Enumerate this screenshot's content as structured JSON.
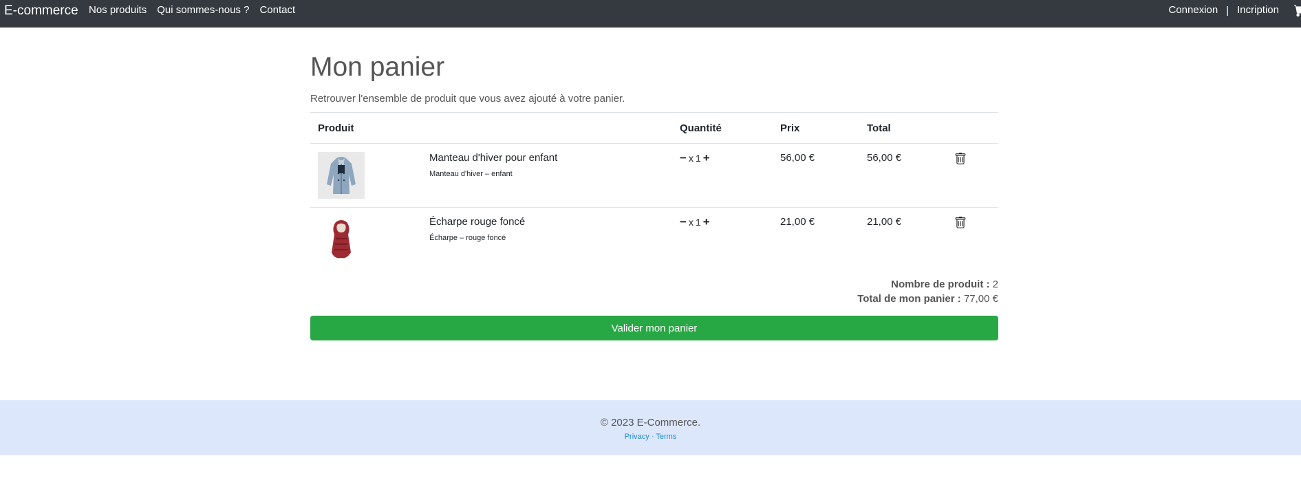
{
  "nav": {
    "brand": "E-commerce",
    "links": [
      "Nos produits",
      "Qui sommes-nous ?",
      "Contact"
    ],
    "login": "Connexion",
    "separator": "|",
    "signup": "Incription",
    "cart_icon": "cart-icon"
  },
  "main": {
    "title": "Mon panier",
    "subtitle": "Retrouver l'ensemble de produit que vous avez ajouté à votre panier."
  },
  "table": {
    "headers": {
      "product": "Produit",
      "quantity": "Quantité",
      "price": "Prix",
      "total": "Total"
    },
    "rows": [
      {
        "name": "Manteau d'hiver pour enfant",
        "desc": "Manteau d'hiver – enfant",
        "qty_prefix": "x",
        "qty": "1",
        "price": "56,00 €",
        "total": "56,00 €",
        "image": "coat-image"
      },
      {
        "name": "Écharpe rouge foncé",
        "desc": "Écharpe – rouge foncé",
        "qty_prefix": "x",
        "qty": "1",
        "price": "21,00 €",
        "total": "21,00 €",
        "image": "scarf-image"
      }
    ]
  },
  "summary": {
    "count_label": "Nombre de produit :",
    "count_value": "2",
    "total_label": "Total de mon panier :",
    "total_value": "77,00 €"
  },
  "validate_label": "Valider mon panier",
  "footer": {
    "copyright": "© 2023 E-Commerce.",
    "privacy": "Privacy",
    "dot": "·",
    "terms": "Terms"
  },
  "colors": {
    "navbar": "#343a40",
    "button": "#28a745",
    "footer": "#dde7fb",
    "link": "#1a8ad1"
  }
}
